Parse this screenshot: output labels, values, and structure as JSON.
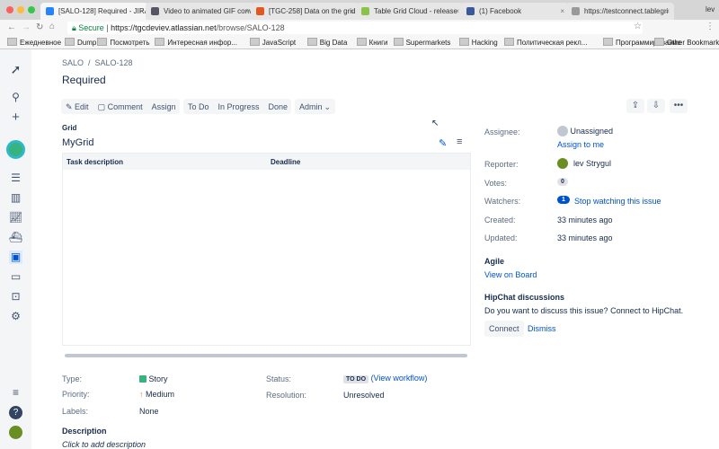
{
  "browser": {
    "tabs": [
      {
        "title": "[SALO-128] Required - JIRA",
        "active": true,
        "color": "#2684ff"
      },
      {
        "title": "Video to animated GIF conv",
        "color": "#556"
      },
      {
        "title": "[TGC-258] Data on the grid",
        "color": "#e25822"
      },
      {
        "title": "Table Grid Cloud - release",
        "color": "#8bc34a"
      },
      {
        "title": "(1) Facebook",
        "color": "#3b5998"
      },
      {
        "title": "https://testconnect.tablegri",
        "color": "#999"
      }
    ],
    "profile": "lev",
    "secure_label": "Secure",
    "url_host": "https://tgcdeviev.atlassian.net",
    "url_path": "/browse/SALO-128",
    "bookmarks": [
      "Ежедневное",
      "Dump",
      "Посмотреть",
      "Интересная инфор...",
      "JavaScript",
      "Big Data",
      "Книги",
      "Supermarkets",
      "Hacking",
      "Политическая рекл...",
      "Программирование"
    ],
    "other_bookmarks": "Other Bookmarks"
  },
  "issue": {
    "breadcrumb": {
      "project": "SALO",
      "key": "SALO-128"
    },
    "title": "Required",
    "toolbar": {
      "edit": "Edit",
      "comment": "Comment",
      "assign": "Assign",
      "todo": "To Do",
      "in_progress": "In Progress",
      "done": "Done",
      "admin": "Admin"
    },
    "grid": {
      "section": "Grid",
      "name": "MyGrid",
      "columns": [
        "Task description",
        "Deadline"
      ]
    },
    "details": {
      "type_label": "Type:",
      "type": "Story",
      "priority_label": "Priority:",
      "priority": "Medium",
      "labels_label": "Labels:",
      "labels": "None",
      "status_label": "Status:",
      "status": "TO DO",
      "view_workflow": "(View workflow)",
      "resolution_label": "Resolution:",
      "resolution": "Unresolved"
    },
    "description": {
      "heading": "Description",
      "placeholder": "Click to add description"
    },
    "people": {
      "assignee_label": "Assignee:",
      "assignee": "Unassigned",
      "assign_to_me": "Assign to me",
      "reporter_label": "Reporter:",
      "reporter": "lev Strygul",
      "votes_label": "Votes:",
      "votes": "0",
      "watchers_label": "Watchers:",
      "watchers": "1",
      "stop_watching": "Stop watching this issue",
      "created_label": "Created:",
      "created": "33 minutes ago",
      "updated_label": "Updated:",
      "updated": "33 minutes ago"
    },
    "agile": {
      "heading": "Agile",
      "view_on_board": "View on Board"
    },
    "hipchat": {
      "heading": "HipChat discussions",
      "text": "Do you want to discuss this issue? Connect to HipChat.",
      "connect": "Connect",
      "dismiss": "Dismiss"
    }
  },
  "colors": {
    "brand": "#0052cc",
    "sidebar": "#f4f5f7"
  }
}
